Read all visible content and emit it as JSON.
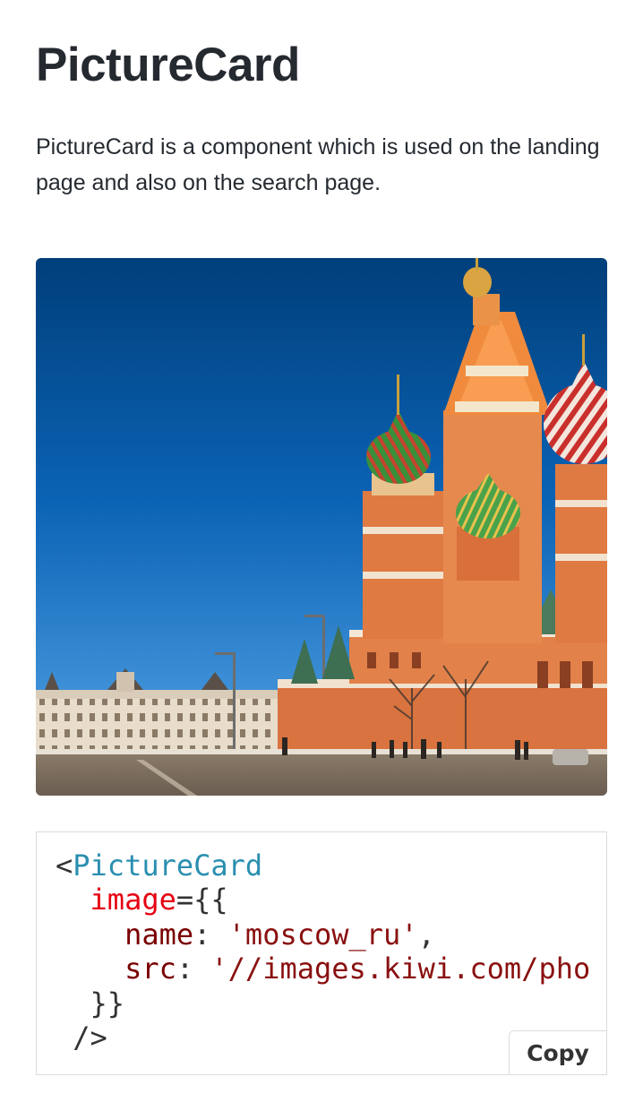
{
  "page": {
    "title": "PictureCard",
    "description": "PictureCard is a component which is used on the landing page and also on the search page."
  },
  "picture": {
    "subject": "moscow-st-basils-cathedral-image"
  },
  "code_example": {
    "lines": [
      {
        "segments": [
          {
            "text": "<",
            "kind": "punct"
          },
          {
            "text": "PictureCard",
            "kind": "tag"
          }
        ]
      },
      {
        "segments": [
          {
            "text": "  ",
            "kind": "punct"
          },
          {
            "text": "image",
            "kind": "attr"
          },
          {
            "text": "={{",
            "kind": "punct"
          }
        ]
      },
      {
        "segments": [
          {
            "text": "    ",
            "kind": "punct"
          },
          {
            "text": "name",
            "kind": "key"
          },
          {
            "text": ": ",
            "kind": "punct"
          },
          {
            "text": "'moscow_ru'",
            "kind": "str"
          },
          {
            "text": ",",
            "kind": "punct"
          }
        ]
      },
      {
        "segments": [
          {
            "text": "    ",
            "kind": "punct"
          },
          {
            "text": "src",
            "kind": "key"
          },
          {
            "text": ": ",
            "kind": "punct"
          },
          {
            "text": "'//images.kiwi.com/pho",
            "kind": "str"
          }
        ]
      },
      {
        "segments": [
          {
            "text": "  }}",
            "kind": "punct"
          }
        ]
      },
      {
        "segments": [
          {
            "text": " />",
            "kind": "punct"
          }
        ]
      }
    ],
    "copy_label": "Copy"
  },
  "colors": {
    "heading": "#252a31",
    "tag": "#2a8fb0",
    "attr": "#e60012",
    "string": "#8a1010",
    "border": "#dcdcdc"
  }
}
